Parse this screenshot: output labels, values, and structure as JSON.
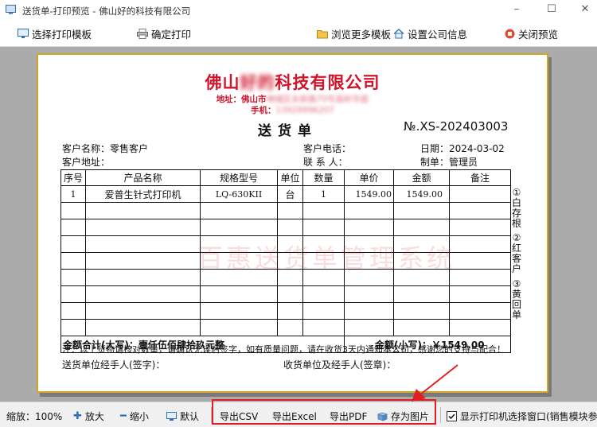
{
  "window": {
    "title": "送货单-打印预览 - 佛山好的科技有限公司"
  },
  "toolbar": {
    "select_template": "选择打印模板",
    "confirm_print": "确定打印",
    "browse_templates": "浏览更多模板",
    "company_settings": "设置公司信息",
    "close_preview": "关闭预览"
  },
  "document": {
    "company_prefix": "佛山",
    "company_blurred": "好的",
    "company_suffix": "科技有限公司",
    "address_label": "地址：佛山市",
    "address_blurred": "禅城区永新路70号昌岭华庭",
    "phone_label": "手机：",
    "phone_blurred": "13929996207",
    "title": "送货单",
    "number": "№.XS-202403003",
    "customer_name": "客户名称：零售客户",
    "customer_phone": "客户电话：",
    "date": "日期：2024-03-02",
    "customer_address": "客户地址：",
    "contact": "联 系 人：",
    "maker": "制单：管理员",
    "columns": [
      "序号",
      "产品名称",
      "规格型号",
      "单位",
      "数量",
      "单价",
      "金额",
      "备注"
    ],
    "rows": [
      [
        "1",
        "爱普生针式打印机",
        "LQ-630KII",
        "台",
        "1",
        "1549.00",
        "1549.00",
        ""
      ]
    ],
    "total_upper": "金额合计(大写)：壹仟伍佰肆拾玖元整",
    "total_lower": "金额(小写)：￥1549.00",
    "note": "注：以上货物请核对数量，请确认无误后签字，如有质量问题，请在收货3天内通知本公司，感谢您的支持与配合！",
    "sender": "送货单位经手人(签字)：",
    "receiver": "收货单位及经手人(签章)：",
    "side_1": "①白存根",
    "side_2": "②红客户",
    "side_3": "③黄回单",
    "watermark": "百惠送货单管理系统"
  },
  "statusbar": {
    "zoom": "缩放：100%",
    "zoom_in": "放大",
    "zoom_out": "缩小",
    "default": "默认",
    "export_csv": "导出CSV",
    "export_excel": "导出Excel",
    "export_pdf": "导出PDF",
    "save_image": "存为图片",
    "show_printer_dialog": "显示打印机选择窗口(销售模块参数"
  },
  "colors": {
    "highlight": "#e02020",
    "company_red": "#d0142a",
    "paper_border": "#d4a521"
  }
}
